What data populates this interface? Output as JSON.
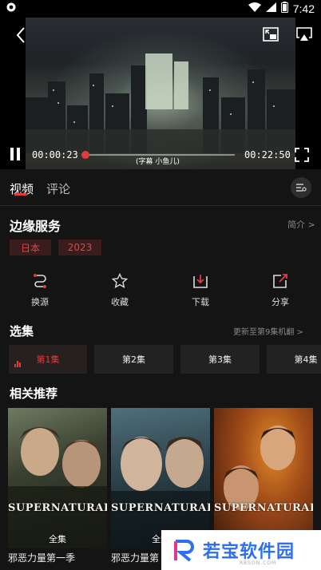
{
  "status_bar": {
    "time": "7:42",
    "icons": [
      "app-shield-icon",
      "wifi-icon",
      "signal-icon",
      "battery-icon"
    ]
  },
  "player": {
    "current_time": "00:00:23",
    "total_time": "00:22:50",
    "progress": 0.017,
    "subtitle": "(字幕 小鱼儿)",
    "accent_color": "#e23a3a"
  },
  "tabs": [
    {
      "label": "视频",
      "active": true
    },
    {
      "label": "评论",
      "active": false
    }
  ],
  "show": {
    "title": "边缘服务",
    "intro_label": "简介 >",
    "tags": [
      "日本",
      "2023"
    ]
  },
  "actions": [
    {
      "label": "换源",
      "icon": "switch-source-icon"
    },
    {
      "label": "收藏",
      "icon": "star-icon"
    },
    {
      "label": "下载",
      "icon": "download-icon"
    },
    {
      "label": "分享",
      "icon": "share-icon"
    }
  ],
  "episodes": {
    "section_title": "选集",
    "update_text": "更新至第9集机翻 >",
    "items": [
      "第1集",
      "第2集",
      "第3集",
      "第4集"
    ],
    "active_index": 0
  },
  "related": {
    "section_title": "相关推荐",
    "items": [
      {
        "caption": "邪恶力量第一季",
        "badge": "全集",
        "logo": "SUPERNATURAL"
      },
      {
        "caption": "邪恶力量第",
        "badge": "全集",
        "logo": "SUPERNATURAL"
      },
      {
        "caption": "",
        "badge": "",
        "logo": "SUPERNATURAL"
      }
    ]
  },
  "watermark": {
    "text": "若宝软件园",
    "sub": "RBSON.COM"
  }
}
